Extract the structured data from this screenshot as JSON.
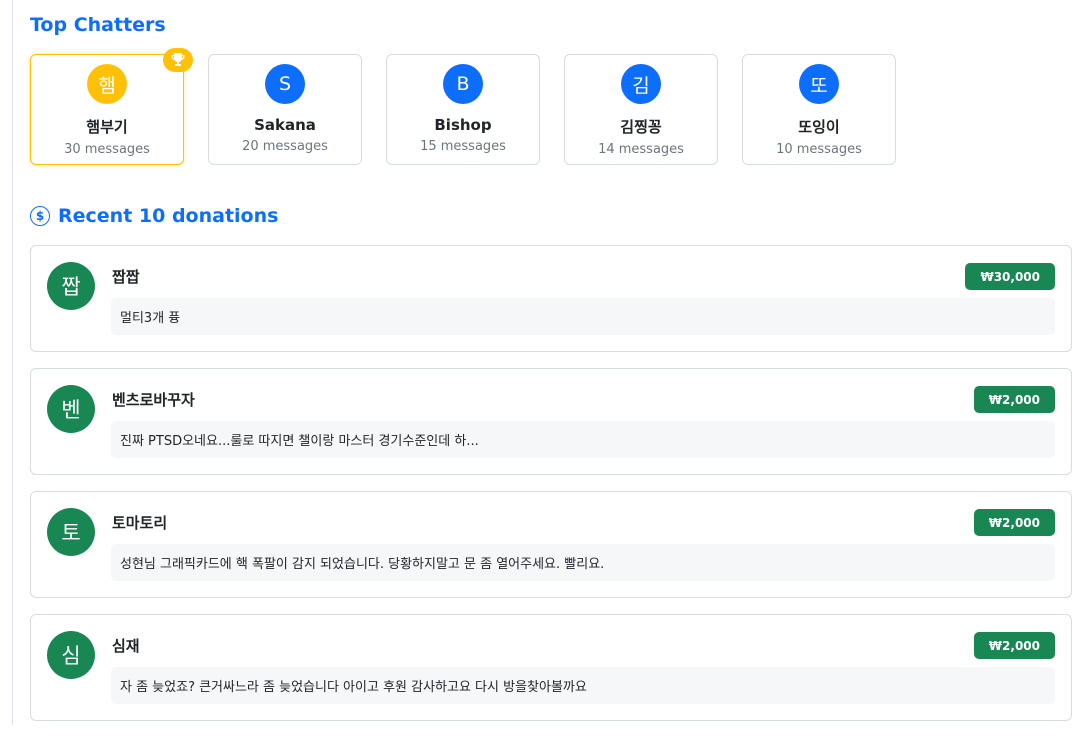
{
  "top_chatters": {
    "title": "Top Chatters",
    "items": [
      {
        "initial": "햄",
        "name": "햄부기",
        "count": "30 messages"
      },
      {
        "initial": "S",
        "name": "Sakana",
        "count": "20 messages"
      },
      {
        "initial": "B",
        "name": "Bishop",
        "count": "15 messages"
      },
      {
        "initial": "김",
        "name": "김찡꽁",
        "count": "14 messages"
      },
      {
        "initial": "또",
        "name": "또잉이",
        "count": "10 messages"
      }
    ]
  },
  "donations": {
    "icon": "$",
    "title": "Recent 10 donations",
    "items": [
      {
        "initial": "짭",
        "name": "짭짭",
        "amount": "₩30,000",
        "message": "멀티3개 퓽"
      },
      {
        "initial": "벤",
        "name": "벤츠로바꾸자",
        "amount": "₩2,000",
        "message": "진짜 PTSD오네요...룰로 따지면 챌이랑 마스터 경기수준인데 하..."
      },
      {
        "initial": "토",
        "name": "토마토리",
        "amount": "₩2,000",
        "message": "성현님 그래픽카드에 핵 폭팔이 감지 되었습니다. 당황하지말고 문 좀 열어주세요. 빨리요."
      },
      {
        "initial": "심",
        "name": "심재",
        "amount": "₩2,000",
        "message": "자 좀 늦었죠? 큰거싸느라 좀 늦었습니다 아이고 후원 감사하고요 다시 방을찾아볼까요"
      }
    ]
  },
  "colors": {
    "accent": "#0d6efd",
    "gold": "#ffc107",
    "success": "#198754"
  },
  "icons": {
    "trophy": "trophy-icon",
    "dollar": "dollar-circle-icon"
  }
}
